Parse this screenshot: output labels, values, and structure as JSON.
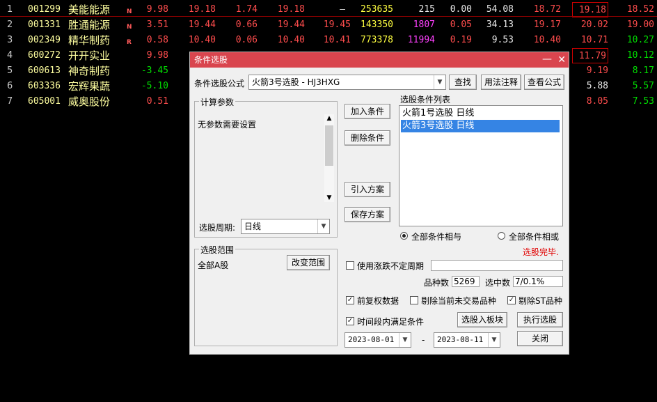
{
  "stocks": [
    {
      "idx": "1",
      "code": "001299",
      "name": "美能能源",
      "flag": "N",
      "c1": "9.98",
      "c2": "19.18",
      "c3": "1.74",
      "c4": "19.18",
      "c5": "—",
      "c6": "253635",
      "c7": "215",
      "c8": "0.00",
      "c9": "54.08",
      "c10": "18.72",
      "c11": "19.18",
      "c12": "18.52"
    },
    {
      "idx": "2",
      "code": "001331",
      "name": "胜通能源",
      "flag": "N",
      "c1": "3.51",
      "c2": "19.44",
      "c3": "0.66",
      "c4": "19.44",
      "c5": "19.45",
      "c6": "143350",
      "c7": "1807",
      "c8": "0.05",
      "c9": "34.13",
      "c10": "19.17",
      "c11": "20.02",
      "c12": "19.00"
    },
    {
      "idx": "3",
      "code": "002349",
      "name": "精华制药",
      "flag": "R",
      "c1": "0.58",
      "c2": "10.40",
      "c3": "0.06",
      "c4": "10.40",
      "c5": "10.41",
      "c6": "773378",
      "c7": "11994",
      "c8": "0.19",
      "c9": "9.53",
      "c10": "10.40",
      "c11": "10.71",
      "c12": "10.27"
    },
    {
      "idx": "4",
      "code": "600272",
      "name": "开开实业",
      "flag": "",
      "c1": "9.98",
      "c11": "11.79",
      "c12": "10.12"
    },
    {
      "idx": "5",
      "code": "600613",
      "name": "神奇制药",
      "flag": "",
      "c1": "-3.45",
      "c11": "9.19",
      "c12": "8.17"
    },
    {
      "idx": "6",
      "code": "603336",
      "name": "宏辉果蔬",
      "flag": "",
      "c1": "-5.10",
      "c11": "5.88",
      "c12": "5.57"
    },
    {
      "idx": "7",
      "code": "605001",
      "name": "威奥股份",
      "flag": "",
      "c1": "0.51",
      "c11": "8.05",
      "c12": "7.53"
    }
  ],
  "dialog": {
    "title": "条件选股",
    "formula_label": "条件选股公式",
    "formula_value": "火箭3号选股  -  HJ3HXG",
    "find_btn": "查找",
    "usage_btn": "用法注释",
    "view_btn": "查看公式",
    "params_caption": "计算参数",
    "params_text": "无参数需要设置",
    "period_label": "选股周期:",
    "period_value": "日线",
    "add_btn": "加入条件",
    "del_btn": "删除条件",
    "import_btn": "引入方案",
    "save_btn": "保存方案",
    "list_caption": "选股条件列表",
    "conditions": [
      "火箭1号选股  日线",
      "火箭3号选股  日线"
    ],
    "radio_and": "全部条件相与",
    "radio_or": "全部条件相或",
    "done_text": "选股完毕.",
    "range_caption": "选股范围",
    "range_value": "全部A股",
    "change_range_btn": "改变范围",
    "use_period_label": "使用涨跌不定周期",
    "count_label": "品种数",
    "count_value": "5269",
    "selected_label": "选中数",
    "selected_value": "7/0.1%",
    "fq_label": "前复权数据",
    "exclude_untraded_label": "剔除当前未交易品种",
    "exclude_st_label": "剔除ST品种",
    "time_cond_label": "时间段内满足条件",
    "to_block_btn": "选股入板块",
    "exec_btn": "执行选股",
    "date_from": "2023-08-01",
    "date_to": "2023-08-11",
    "date_sep": "-",
    "close_btn": "关闭",
    "checks": {
      "use_period": false,
      "fq": true,
      "exclude_untraded": false,
      "exclude_st": true,
      "time_cond": true
    }
  },
  "colors": {
    "title_bar": "#d9454e",
    "selection": "#3584e4",
    "done_text": "#e00000"
  }
}
